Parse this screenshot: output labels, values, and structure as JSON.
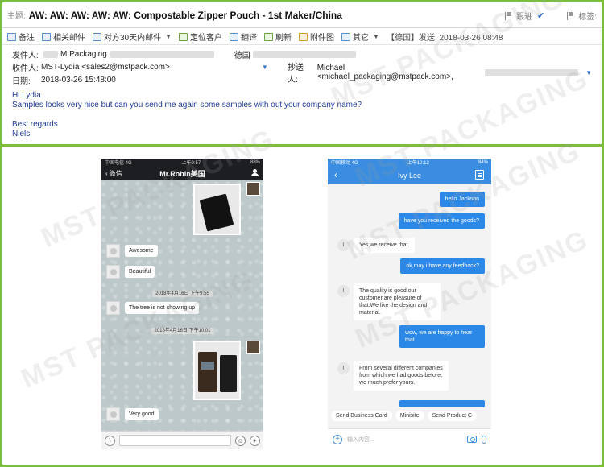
{
  "email": {
    "subject_label": "主题:",
    "subject": "AW: AW: AW: AW: AW: Compostable Zipper Pouch - 1st Maker/China",
    "follow_up": "跟进",
    "tags_label": "标签:",
    "toolbar": [
      {
        "name": "note",
        "label": "备注"
      },
      {
        "name": "related-mail",
        "label": "相关邮件"
      },
      {
        "name": "last-30-days",
        "label": "对方30天内邮件"
      },
      {
        "name": "locate-customer",
        "label": "定位客户"
      },
      {
        "name": "translate",
        "label": "翻译"
      },
      {
        "name": "refresh",
        "label": "刷新"
      },
      {
        "name": "attachment-view",
        "label": "附件图"
      },
      {
        "name": "other",
        "label": "其它"
      }
    ],
    "sent_info": "【德国】发送: 2018-03-26 08:48",
    "from_label": "发件人:",
    "from_value": "M Packaging",
    "from_tag": "德国",
    "to_label": "收件人:",
    "to_value": "MST-Lydia <sales2@mstpack.com>",
    "cc_label": "抄送人:",
    "cc_value": "Michael <michael_packaging@mstpack.com>,",
    "date_label": "日期:",
    "date_value": "2018-03-26 15:48:00",
    "body": {
      "greeting": "Hi Lydia",
      "line1": "Samples looks very nice but can you send me again some samples with out your company name?",
      "closing": "Best regards",
      "signature": "Niels"
    }
  },
  "watermark": "MST PACKAGING",
  "wechat": {
    "carrier": "中国电信  4G",
    "time": "上午9:57",
    "battery": "88%",
    "back_label": "微信",
    "title": "Mr.Robin美国",
    "messages": {
      "m1": "Awesome",
      "m2": "Beautiful",
      "t1": "2018年4月16日 下午9:55",
      "m3": "The tree is not showing up",
      "t2": "2018年4月16日 下午10:01",
      "m4": "Very good"
    }
  },
  "chat2": {
    "carrier": "中国移动  4G",
    "time": "上午10:12",
    "battery": "84%",
    "title": "Ivy Lee",
    "avatar_letter": "I",
    "messages": {
      "b1": "hello Jackson",
      "b2": "have you received the goods?",
      "w1": "Yes,we receive that.",
      "b3": "ok,may i have any feedback?",
      "w2": "The quality is good,our customer are pleasure of that.We like the design and material.",
      "b4": "wow, we are happy to hear that",
      "w3": "From several different companies from which we had goods before, we much prefer yours."
    },
    "quick_replies": [
      "Send Business Card",
      "Minisite",
      "Send Product C"
    ],
    "input_placeholder": "输入内容..."
  },
  "colors": {
    "frame": "#7cbd3c",
    "email_body": "#1f3a93",
    "chat_blue": "#2c88e7",
    "wechat_dark": "#1d1e22"
  }
}
